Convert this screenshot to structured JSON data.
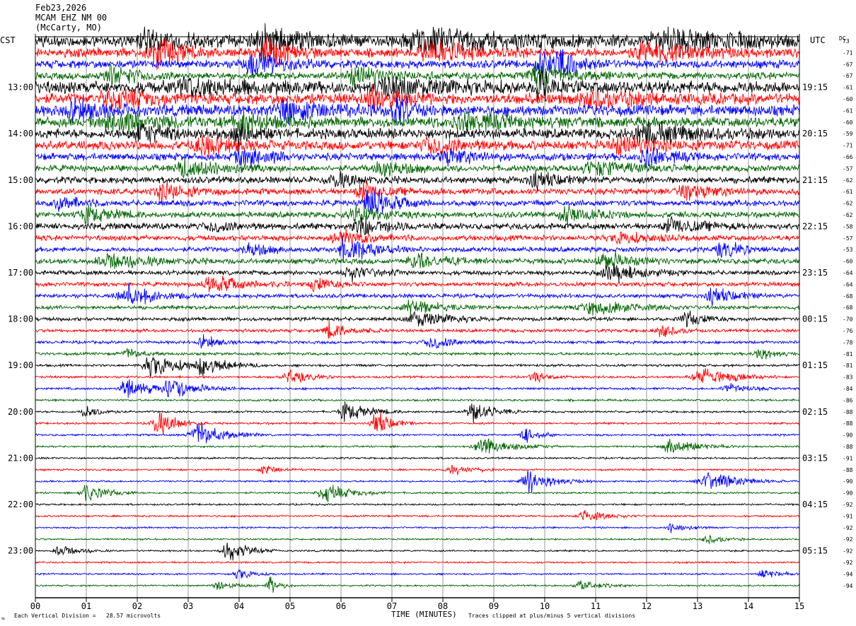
{
  "header": {
    "date": "Feb23,2026",
    "station": "MCAM EHZ NM 00",
    "location": "(McCarty, MO)"
  },
  "labels": {
    "left_tz": "CST",
    "right_tz": "UTC",
    "dc_header": "DC",
    "xlabel": "TIME (MINUTES)",
    "scale_note": "Each Vertical Division =   28.57 microvolts",
    "clip_note": "Traces clipped at plus/minus 5 vertical divisions",
    "corner_mark": "≈"
  },
  "colors": {
    "background": "#ffffff",
    "grid": "#7f7f7f",
    "trace_cycle": [
      "#000000",
      "#ff0000",
      "#0000ff",
      "#006400"
    ]
  },
  "chart_data": {
    "type": "line",
    "title": "Feb23,2026 MCAM EHZ NM 00 (McCarty, MO)",
    "xlabel": "TIME (MINUTES)",
    "xlim": [
      0,
      15
    ],
    "x_ticks": [
      "00",
      "01",
      "02",
      "03",
      "04",
      "05",
      "06",
      "07",
      "08",
      "09",
      "10",
      "11",
      "12",
      "13",
      "14",
      "15"
    ],
    "rows_per_hour": 4,
    "row_count": 48,
    "left_hour_labels": [
      {
        "row": 4,
        "label": "13:00"
      },
      {
        "row": 8,
        "label": "14:00"
      },
      {
        "row": 12,
        "label": "15:00"
      },
      {
        "row": 16,
        "label": "16:00"
      },
      {
        "row": 20,
        "label": "17:00"
      },
      {
        "row": 24,
        "label": "18:00"
      },
      {
        "row": 28,
        "label": "19:00"
      },
      {
        "row": 32,
        "label": "20:00"
      },
      {
        "row": 36,
        "label": "21:00"
      },
      {
        "row": 40,
        "label": "22:00"
      },
      {
        "row": 44,
        "label": "23:00"
      }
    ],
    "right_hour_labels": [
      {
        "row": 4,
        "label": "19:15"
      },
      {
        "row": 8,
        "label": "20:15"
      },
      {
        "row": 12,
        "label": "21:15"
      },
      {
        "row": 16,
        "label": "22:15"
      },
      {
        "row": 20,
        "label": "23:15"
      },
      {
        "row": 24,
        "label": "00:15"
      },
      {
        "row": 28,
        "label": "01:15"
      },
      {
        "row": 32,
        "label": "02:15"
      },
      {
        "row": 36,
        "label": "03:15"
      },
      {
        "row": 40,
        "label": "04:15"
      },
      {
        "row": 44,
        "label": "05:15"
      }
    ],
    "dc_offsets": [
      "73",
      "-71",
      "-67",
      "-67",
      "-61",
      "-60",
      "-61",
      "-60",
      "-59",
      "-71",
      "-66",
      "-57",
      "-62",
      "-61",
      "-62",
      "-62",
      "-58",
      "-57",
      "-53",
      "-60",
      "-64",
      "-64",
      "-68",
      "-68",
      "-70",
      "-76",
      "-78",
      "-81",
      "-81",
      "-83",
      "-84",
      "-86",
      "-88",
      "-88",
      "-90",
      "-88",
      "-91",
      "-88",
      "-90",
      "-90",
      "-92",
      "-91",
      "-92",
      "-92",
      "-92",
      "-92",
      "-94",
      "-94"
    ],
    "row_amplitude": [
      2.6,
      2.0,
      1.8,
      1.6,
      2.8,
      2.4,
      2.4,
      2.2,
      2.2,
      2.0,
      1.6,
      1.4,
      1.5,
      1.4,
      1.3,
      1.3,
      1.4,
      1.2,
      1.1,
      1.2,
      1.0,
      0.95,
      0.9,
      0.85,
      0.8,
      0.7,
      0.65,
      0.6,
      0.55,
      0.5,
      0.5,
      0.45,
      0.45,
      0.45,
      0.45,
      0.4,
      0.4,
      0.4,
      0.4,
      0.4,
      0.4,
      0.4,
      0.38,
      0.38,
      0.38,
      0.38,
      0.38,
      0.36
    ],
    "events": [
      {
        "row": 0,
        "t": 2.2,
        "w": 0.6,
        "a": 6
      },
      {
        "row": 0,
        "t": 4.5,
        "w": 0.8,
        "a": 7
      },
      {
        "row": 0,
        "t": 7.8,
        "w": 1.5,
        "a": 6
      },
      {
        "row": 0,
        "t": 12.5,
        "w": 1.5,
        "a": 6
      },
      {
        "row": 1,
        "t": 2.4,
        "w": 0.5,
        "a": 8
      },
      {
        "row": 1,
        "t": 4.6,
        "w": 0.4,
        "a": 9
      },
      {
        "row": 1,
        "t": 7.8,
        "w": 0.8,
        "a": 6
      },
      {
        "row": 1,
        "t": 12.0,
        "w": 1.0,
        "a": 5
      },
      {
        "row": 2,
        "t": 4.3,
        "w": 0.6,
        "a": 6
      },
      {
        "row": 2,
        "t": 9.9,
        "w": 0.3,
        "a": 8
      },
      {
        "row": 2,
        "t": 10.3,
        "w": 0.4,
        "a": 6
      },
      {
        "row": 3,
        "t": 1.5,
        "w": 0.6,
        "a": 5
      },
      {
        "row": 3,
        "t": 6.3,
        "w": 0.6,
        "a": 5
      },
      {
        "row": 3,
        "t": 9.9,
        "w": 0.6,
        "a": 6
      },
      {
        "row": 4,
        "t": 3.0,
        "w": 1.0,
        "a": 5
      },
      {
        "row": 4,
        "t": 7.0,
        "w": 1.0,
        "a": 5
      },
      {
        "row": 4,
        "t": 9.9,
        "w": 0.3,
        "a": 8
      },
      {
        "row": 5,
        "t": 1.5,
        "w": 0.8,
        "a": 5
      },
      {
        "row": 5,
        "t": 6.6,
        "w": 0.5,
        "a": 6
      },
      {
        "row": 5,
        "t": 11.0,
        "w": 1.0,
        "a": 4
      },
      {
        "row": 6,
        "t": 0.8,
        "w": 0.6,
        "a": 5
      },
      {
        "row": 6,
        "t": 5.0,
        "w": 1.0,
        "a": 5
      },
      {
        "row": 6,
        "t": 7.1,
        "w": 0.3,
        "a": 8
      },
      {
        "row": 7,
        "t": 1.6,
        "w": 1.0,
        "a": 5
      },
      {
        "row": 7,
        "t": 4.1,
        "w": 0.6,
        "a": 6
      },
      {
        "row": 7,
        "t": 8.5,
        "w": 1.0,
        "a": 4
      },
      {
        "row": 8,
        "t": 2.1,
        "w": 0.6,
        "a": 5
      },
      {
        "row": 8,
        "t": 4.0,
        "w": 0.4,
        "a": 6
      },
      {
        "row": 8,
        "t": 12.0,
        "w": 1.0,
        "a": 5
      },
      {
        "row": 9,
        "t": 3.3,
        "w": 0.6,
        "a": 5
      },
      {
        "row": 9,
        "t": 7.8,
        "w": 0.6,
        "a": 5
      },
      {
        "row": 9,
        "t": 11.5,
        "w": 0.8,
        "a": 4
      },
      {
        "row": 10,
        "t": 4.1,
        "w": 0.5,
        "a": 6
      },
      {
        "row": 10,
        "t": 8.1,
        "w": 0.6,
        "a": 4
      },
      {
        "row": 10,
        "t": 12.0,
        "w": 0.5,
        "a": 5
      },
      {
        "row": 11,
        "t": 3.0,
        "w": 0.8,
        "a": 5
      },
      {
        "row": 11,
        "t": 6.8,
        "w": 0.5,
        "a": 5
      },
      {
        "row": 11,
        "t": 11.0,
        "w": 0.8,
        "a": 4
      },
      {
        "row": 12,
        "t": 5.9,
        "w": 0.5,
        "a": 4
      },
      {
        "row": 12,
        "t": 9.8,
        "w": 0.5,
        "a": 4
      },
      {
        "row": 13,
        "t": 2.5,
        "w": 0.5,
        "a": 5
      },
      {
        "row": 13,
        "t": 6.4,
        "w": 0.4,
        "a": 5
      },
      {
        "row": 13,
        "t": 12.8,
        "w": 0.6,
        "a": 4
      },
      {
        "row": 14,
        "t": 6.6,
        "w": 0.5,
        "a": 8
      },
      {
        "row": 14,
        "t": 0.5,
        "w": 0.4,
        "a": 4
      },
      {
        "row": 15,
        "t": 10.4,
        "w": 0.5,
        "a": 5
      },
      {
        "row": 15,
        "t": 1.0,
        "w": 0.6,
        "a": 4
      },
      {
        "row": 15,
        "t": 6.3,
        "w": 0.5,
        "a": 5
      },
      {
        "row": 16,
        "t": 6.4,
        "w": 0.6,
        "a": 5
      },
      {
        "row": 16,
        "t": 3.5,
        "w": 0.5,
        "a": 3
      },
      {
        "row": 16,
        "t": 12.5,
        "w": 0.6,
        "a": 4
      },
      {
        "row": 17,
        "t": 6.0,
        "w": 0.6,
        "a": 4
      },
      {
        "row": 17,
        "t": 11.5,
        "w": 0.6,
        "a": 3
      },
      {
        "row": 18,
        "t": 6.1,
        "w": 0.6,
        "a": 6
      },
      {
        "row": 18,
        "t": 13.5,
        "w": 0.5,
        "a": 4
      },
      {
        "row": 18,
        "t": 4.2,
        "w": 0.4,
        "a": 4
      },
      {
        "row": 19,
        "t": 1.5,
        "w": 0.8,
        "a": 4
      },
      {
        "row": 19,
        "t": 7.5,
        "w": 0.6,
        "a": 4
      },
      {
        "row": 19,
        "t": 11.2,
        "w": 0.5,
        "a": 5
      },
      {
        "row": 20,
        "t": 11.3,
        "w": 0.6,
        "a": 5
      },
      {
        "row": 20,
        "t": 6.2,
        "w": 0.5,
        "a": 4
      },
      {
        "row": 21,
        "t": 3.5,
        "w": 0.6,
        "a": 5
      },
      {
        "row": 21,
        "t": 5.5,
        "w": 0.4,
        "a": 4
      },
      {
        "row": 22,
        "t": 1.8,
        "w": 0.6,
        "a": 6
      },
      {
        "row": 22,
        "t": 13.3,
        "w": 0.5,
        "a": 4
      },
      {
        "row": 23,
        "t": 7.4,
        "w": 0.6,
        "a": 4
      },
      {
        "row": 23,
        "t": 11.0,
        "w": 0.8,
        "a": 4
      },
      {
        "row": 24,
        "t": 7.5,
        "w": 0.6,
        "a": 5
      },
      {
        "row": 24,
        "t": 12.8,
        "w": 0.4,
        "a": 4
      },
      {
        "row": 25,
        "t": 5.8,
        "w": 0.4,
        "a": 5
      },
      {
        "row": 25,
        "t": 12.3,
        "w": 0.3,
        "a": 4
      },
      {
        "row": 26,
        "t": 7.8,
        "w": 0.5,
        "a": 4
      },
      {
        "row": 26,
        "t": 3.3,
        "w": 0.3,
        "a": 4
      },
      {
        "row": 27,
        "t": 14.2,
        "w": 0.3,
        "a": 4
      },
      {
        "row": 27,
        "t": 1.8,
        "w": 0.3,
        "a": 3
      },
      {
        "row": 28,
        "t": 2.3,
        "w": 0.6,
        "a": 6
      },
      {
        "row": 28,
        "t": 3.3,
        "w": 0.5,
        "a": 5
      },
      {
        "row": 29,
        "t": 5.0,
        "w": 0.4,
        "a": 4
      },
      {
        "row": 29,
        "t": 9.8,
        "w": 0.3,
        "a": 3
      },
      {
        "row": 29,
        "t": 13.1,
        "w": 0.6,
        "a": 5
      },
      {
        "row": 30,
        "t": 1.8,
        "w": 0.5,
        "a": 6
      },
      {
        "row": 30,
        "t": 2.7,
        "w": 0.5,
        "a": 6
      },
      {
        "row": 30,
        "t": 13.6,
        "w": 0.4,
        "a": 3
      },
      {
        "row": 32,
        "t": 1.0,
        "w": 0.3,
        "a": 4
      },
      {
        "row": 32,
        "t": 6.1,
        "w": 0.5,
        "a": 5
      },
      {
        "row": 32,
        "t": 8.6,
        "w": 0.4,
        "a": 6
      },
      {
        "row": 33,
        "t": 2.4,
        "w": 0.4,
        "a": 7
      },
      {
        "row": 33,
        "t": 6.7,
        "w": 0.3,
        "a": 7
      },
      {
        "row": 34,
        "t": 3.2,
        "w": 0.5,
        "a": 7
      },
      {
        "row": 34,
        "t": 9.6,
        "w": 0.3,
        "a": 4
      },
      {
        "row": 35,
        "t": 8.8,
        "w": 0.6,
        "a": 5
      },
      {
        "row": 35,
        "t": 12.5,
        "w": 0.5,
        "a": 5
      },
      {
        "row": 37,
        "t": 4.5,
        "w": 0.3,
        "a": 3
      },
      {
        "row": 37,
        "t": 8.2,
        "w": 0.4,
        "a": 3
      },
      {
        "row": 38,
        "t": 9.7,
        "w": 0.5,
        "a": 6
      },
      {
        "row": 38,
        "t": 13.2,
        "w": 0.6,
        "a": 5
      },
      {
        "row": 39,
        "t": 1.0,
        "w": 0.4,
        "a": 5
      },
      {
        "row": 39,
        "t": 5.7,
        "w": 0.5,
        "a": 5
      },
      {
        "row": 41,
        "t": 10.8,
        "w": 0.5,
        "a": 3
      },
      {
        "row": 42,
        "t": 12.5,
        "w": 0.3,
        "a": 3
      },
      {
        "row": 43,
        "t": 13.2,
        "w": 0.3,
        "a": 3
      },
      {
        "row": 44,
        "t": 0.5,
        "w": 0.4,
        "a": 3
      },
      {
        "row": 44,
        "t": 3.8,
        "w": 0.4,
        "a": 6
      },
      {
        "row": 46,
        "t": 4.0,
        "w": 0.3,
        "a": 3
      },
      {
        "row": 46,
        "t": 14.3,
        "w": 0.3,
        "a": 3
      },
      {
        "row": 47,
        "t": 4.6,
        "w": 0.2,
        "a": 5
      },
      {
        "row": 47,
        "t": 3.6,
        "w": 0.3,
        "a": 3
      },
      {
        "row": 47,
        "t": 10.7,
        "w": 0.4,
        "a": 3
      }
    ]
  }
}
